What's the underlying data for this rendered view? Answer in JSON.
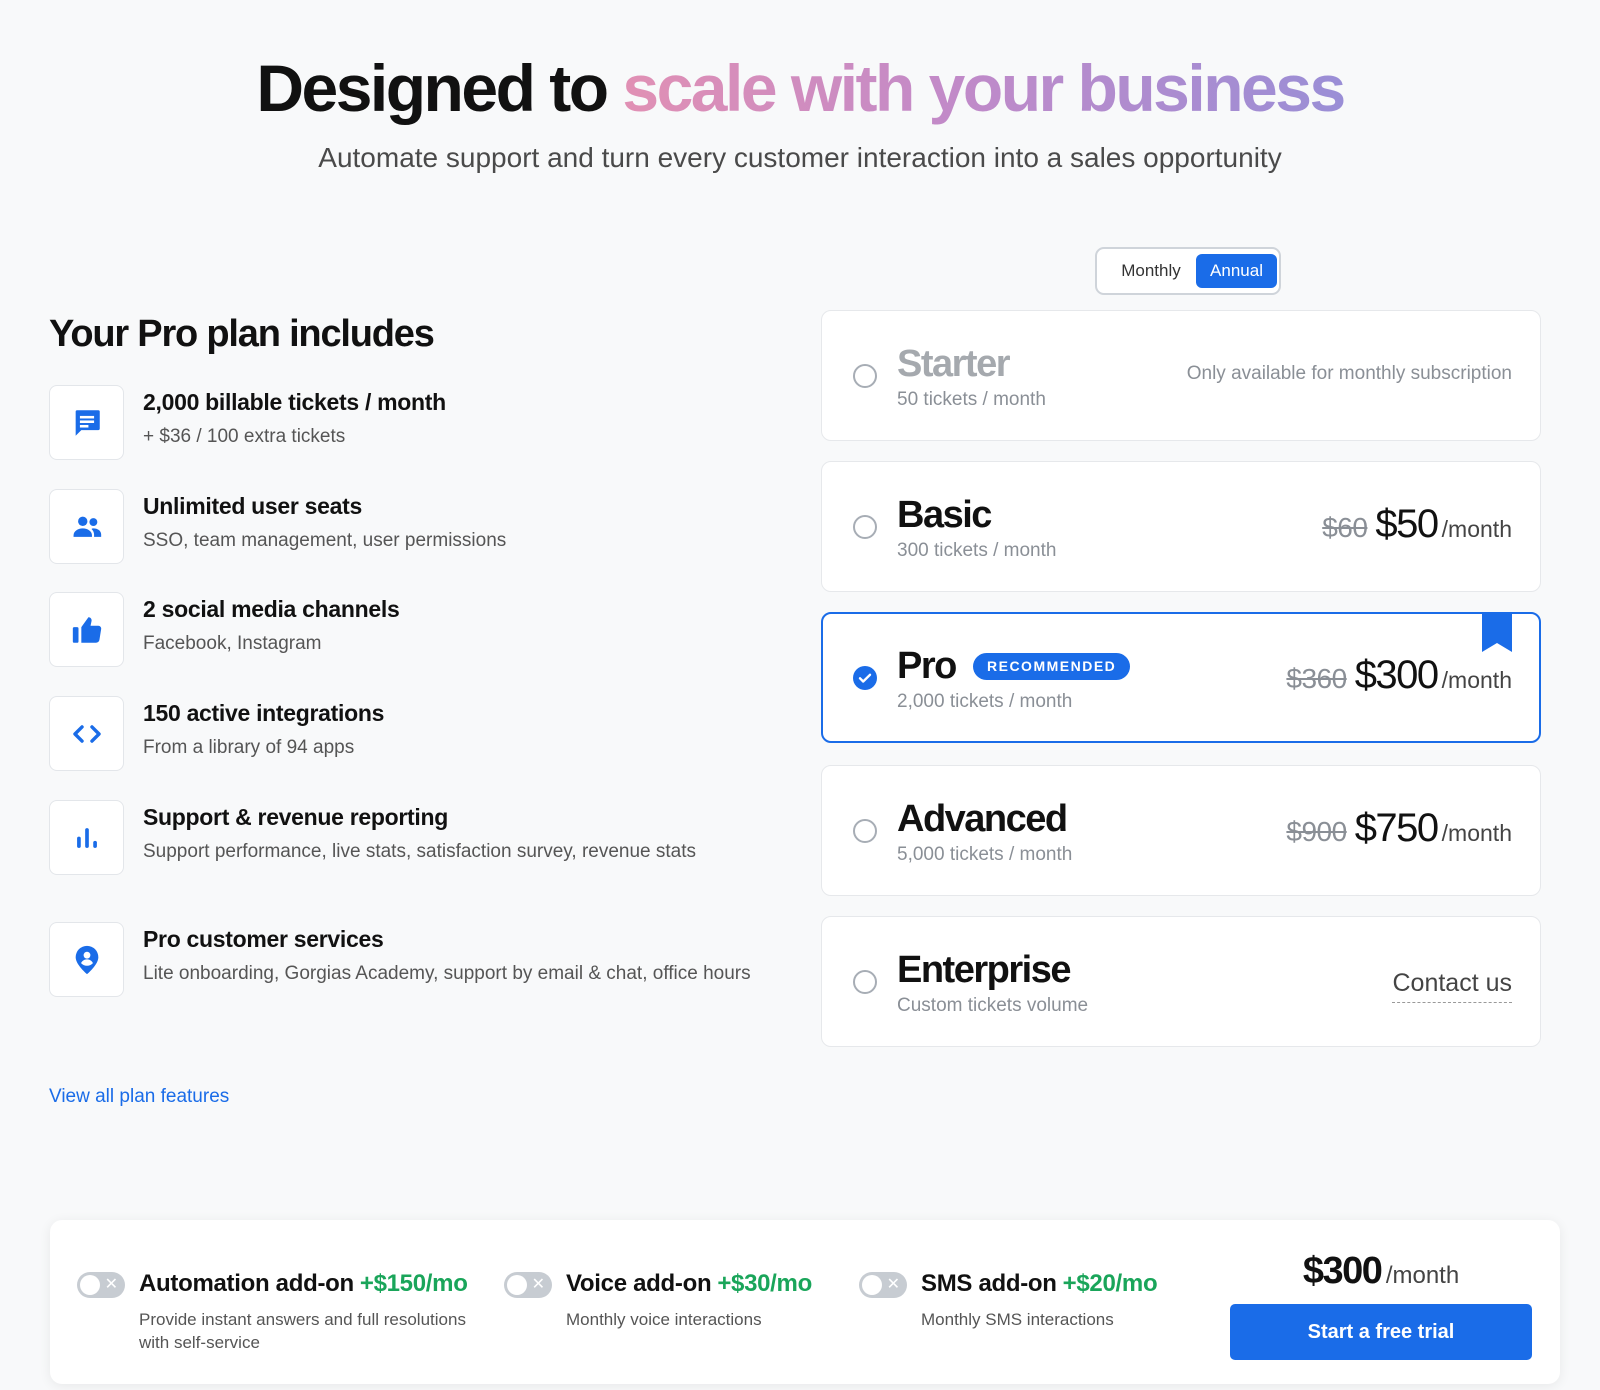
{
  "hero": {
    "title_plain": "Designed to",
    "title_accent": "scale with your business",
    "subtitle": "Automate support and turn every customer interaction into a sales opportunity"
  },
  "plan_includes": {
    "title": "Your Pro plan includes",
    "features": [
      {
        "icon": "chat-icon",
        "title": "2,000 billable tickets / month",
        "desc": "+ $36 / 100 extra tickets"
      },
      {
        "icon": "users-icon",
        "title": "Unlimited user seats",
        "desc": "SSO, team management, user permissions"
      },
      {
        "icon": "thumbs-up-icon",
        "title": "2 social media channels",
        "desc": "Facebook, Instagram"
      },
      {
        "icon": "code-icon",
        "title": "150 active integrations",
        "desc": "From a library of 94 apps"
      },
      {
        "icon": "bar-chart-icon",
        "title": "Support & revenue reporting",
        "desc": "Support performance, live stats, satisfaction survey, revenue stats"
      },
      {
        "icon": "person-pin-icon",
        "title": "Pro customer services",
        "desc": "Lite onboarding, Gorgias Academy, support by email & chat, office hours"
      }
    ],
    "view_all_link": "View all plan features"
  },
  "billing_toggle": {
    "options": [
      "Monthly",
      "Annual"
    ],
    "selected": "Annual"
  },
  "plans": [
    {
      "name": "Starter",
      "tickets": "50 tickets / month",
      "note": "Only available for monthly subscription",
      "disabled": true,
      "selected": false
    },
    {
      "name": "Basic",
      "tickets": "300 tickets / month",
      "old_price": "$60",
      "price": "$50",
      "period": "/month",
      "selected": false
    },
    {
      "name": "Pro",
      "tickets": "2,000 tickets / month",
      "badge": "RECOMMENDED",
      "old_price": "$360",
      "price": "$300",
      "period": "/month",
      "selected": true
    },
    {
      "name": "Advanced",
      "tickets": "5,000 tickets / month",
      "old_price": "$900",
      "price": "$750",
      "period": "/month",
      "selected": false
    },
    {
      "name": "Enterprise",
      "tickets": "Custom tickets volume",
      "contact": "Contact us",
      "selected": false
    }
  ],
  "addons": [
    {
      "name": "Automation add-on",
      "price": "+$150/mo",
      "desc": "Provide instant answers and full resolutions with self-service",
      "enabled": false
    },
    {
      "name": "Voice add-on",
      "price": "+$30/mo",
      "desc": "Monthly voice interactions",
      "enabled": false
    },
    {
      "name": "SMS add-on",
      "price": "+$20/mo",
      "desc": "Monthly SMS interactions",
      "enabled": false
    }
  ],
  "summary": {
    "total": "$300",
    "period": "/month",
    "cta": "Start a free trial"
  },
  "colors": {
    "accent": "#1a6ce8",
    "addon_price": "#1aa55a",
    "gradient_start": "#e190b4",
    "gradient_end": "#9a8ed6"
  }
}
